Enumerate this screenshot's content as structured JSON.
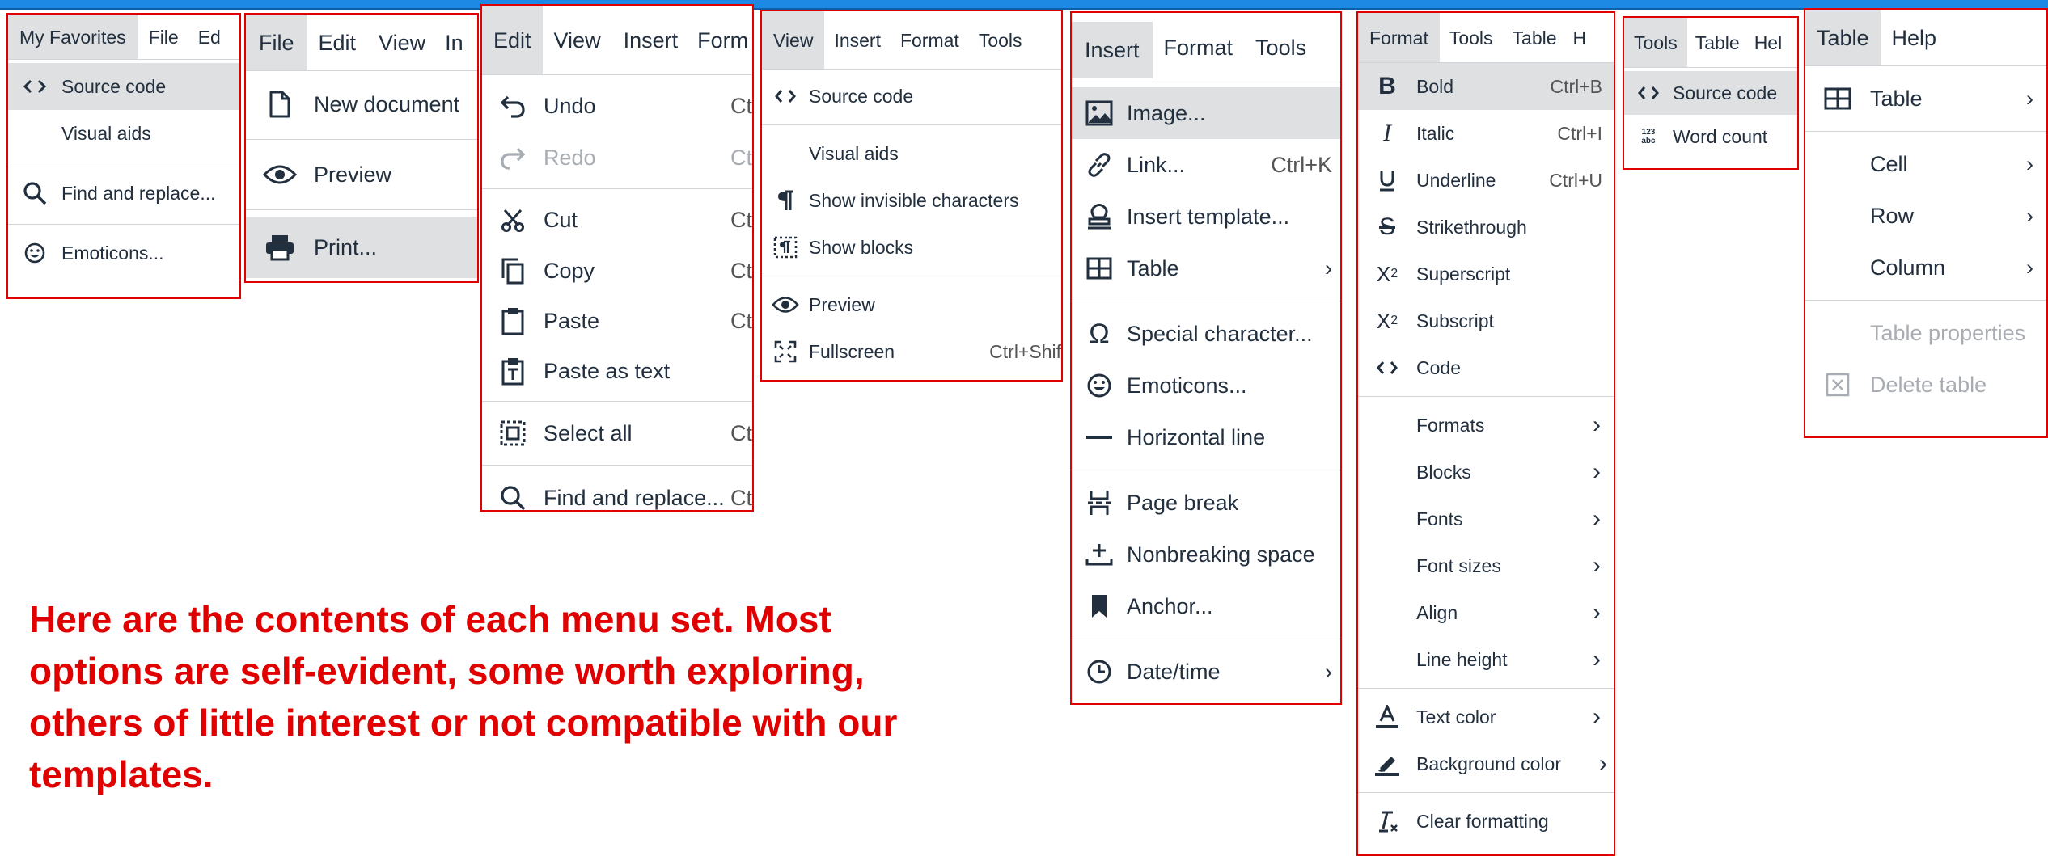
{
  "menus": {
    "favorites": {
      "bar": [
        "My Favorites",
        "File",
        "Ed"
      ],
      "items": [
        {
          "label": "Source code",
          "icon": "source-code-icon"
        },
        {
          "label": "Visual aids",
          "icon": ""
        },
        {
          "label": "Find and replace...",
          "icon": "search-icon"
        },
        {
          "label": "Emoticons...",
          "icon": "emoticons-icon"
        }
      ]
    },
    "file": {
      "bar": [
        "File",
        "Edit",
        "View",
        "In"
      ],
      "items": [
        {
          "label": "New document",
          "icon": "new-document-icon"
        },
        {
          "label": "Preview",
          "icon": "preview-icon"
        },
        {
          "label": "Print...",
          "icon": "print-icon"
        }
      ]
    },
    "edit": {
      "bar": [
        "Edit",
        "View",
        "Insert",
        "Form"
      ],
      "items": [
        {
          "label": "Undo",
          "shortcut": "Ct",
          "icon": "undo-icon"
        },
        {
          "label": "Redo",
          "shortcut": "Ct",
          "icon": "redo-icon"
        },
        {
          "label": "Cut",
          "shortcut": "Ct",
          "icon": "cut-icon"
        },
        {
          "label": "Copy",
          "shortcut": "Ct",
          "icon": "copy-icon"
        },
        {
          "label": "Paste",
          "shortcut": "Ct",
          "icon": "paste-icon"
        },
        {
          "label": "Paste as text",
          "shortcut": "",
          "icon": "paste-as-text-icon"
        },
        {
          "label": "Select all",
          "shortcut": "Ct",
          "icon": "select-all-icon"
        },
        {
          "label": "Find and replace...",
          "shortcut": "Ct",
          "icon": "search-icon"
        }
      ]
    },
    "view": {
      "bar": [
        "View",
        "Insert",
        "Format",
        "Tools"
      ],
      "items": [
        {
          "label": "Source code",
          "shortcut": "",
          "icon": "source-code-icon"
        },
        {
          "label": "Visual aids",
          "shortcut": "",
          "icon": ""
        },
        {
          "label": "Show invisible characters",
          "shortcut": "",
          "icon": "pilcrow-icon"
        },
        {
          "label": "Show blocks",
          "shortcut": "",
          "icon": "show-blocks-icon"
        },
        {
          "label": "Preview",
          "shortcut": "",
          "icon": "preview-icon"
        },
        {
          "label": "Fullscreen",
          "shortcut": "Ctrl+Shif",
          "icon": "fullscreen-icon"
        }
      ]
    },
    "insert": {
      "bar": [
        "Insert",
        "Format",
        "Tools"
      ],
      "items": [
        {
          "label": "Image...",
          "shortcut": "",
          "icon": "image-icon"
        },
        {
          "label": "Link...",
          "shortcut": "Ctrl+K",
          "icon": "link-icon"
        },
        {
          "label": "Insert template...",
          "shortcut": "",
          "icon": "template-icon"
        },
        {
          "label": "Table",
          "shortcut": "",
          "icon": "table-icon"
        },
        {
          "label": "Special character...",
          "shortcut": "",
          "icon": "omega-icon"
        },
        {
          "label": "Emoticons...",
          "shortcut": "",
          "icon": "emoticons-icon"
        },
        {
          "label": "Horizontal line",
          "shortcut": "",
          "icon": "horizontal-line-icon"
        },
        {
          "label": "Page break",
          "shortcut": "",
          "icon": "page-break-icon"
        },
        {
          "label": "Nonbreaking space",
          "shortcut": "",
          "icon": "nonbreaking-space-icon"
        },
        {
          "label": "Anchor...",
          "shortcut": "",
          "icon": "bookmark-icon"
        },
        {
          "label": "Date/time",
          "shortcut": "",
          "icon": "clock-icon"
        }
      ]
    },
    "format": {
      "bar": [
        "Format",
        "Tools",
        "Table",
        "H"
      ],
      "items": [
        {
          "label": "Bold",
          "shortcut": "Ctrl+B",
          "icon": "bold-icon"
        },
        {
          "label": "Italic",
          "shortcut": "Ctrl+I",
          "icon": "italic-icon"
        },
        {
          "label": "Underline",
          "shortcut": "Ctrl+U",
          "icon": "underline-icon"
        },
        {
          "label": "Strikethrough",
          "shortcut": "",
          "icon": "strikethrough-icon"
        },
        {
          "label": "Superscript",
          "shortcut": "",
          "icon": "superscript-icon"
        },
        {
          "label": "Subscript",
          "shortcut": "",
          "icon": "subscript-icon"
        },
        {
          "label": "Code",
          "shortcut": "",
          "icon": "source-code-icon"
        },
        {
          "label": "Formats",
          "shortcut": "",
          "icon": ""
        },
        {
          "label": "Blocks",
          "shortcut": "",
          "icon": ""
        },
        {
          "label": "Fonts",
          "shortcut": "",
          "icon": ""
        },
        {
          "label": "Font sizes",
          "shortcut": "",
          "icon": ""
        },
        {
          "label": "Align",
          "shortcut": "",
          "icon": ""
        },
        {
          "label": "Line height",
          "shortcut": "",
          "icon": ""
        },
        {
          "label": "Text color",
          "shortcut": "",
          "icon": "text-color-icon"
        },
        {
          "label": "Background color",
          "shortcut": "",
          "icon": "highlight-icon"
        },
        {
          "label": "Clear formatting",
          "shortcut": "",
          "icon": "clear-formatting-icon"
        }
      ]
    },
    "tools": {
      "bar": [
        "Tools",
        "Table",
        "Hel"
      ],
      "items": [
        {
          "label": "Source code",
          "icon": "source-code-icon"
        },
        {
          "label": "Word count",
          "icon": "word-count-icon",
          "badge_top": "123",
          "badge_bottom": "abc"
        }
      ]
    },
    "table": {
      "bar": [
        "Table",
        "Help"
      ],
      "items": [
        {
          "label": "Table",
          "icon": "table-icon"
        },
        {
          "label": "Cell",
          "icon": ""
        },
        {
          "label": "Row",
          "icon": ""
        },
        {
          "label": "Column",
          "icon": ""
        },
        {
          "label": "Table properties",
          "icon": ""
        },
        {
          "label": "Delete table",
          "icon": "delete-table-icon"
        }
      ]
    }
  },
  "caption": "Here are the contents of each menu set. Most options are self-evident, some worth exploring, others of little interest or not compatible with our templates.",
  "colors": {
    "outline": "#e00000",
    "highlight": "#dee0e2",
    "text": "#222f3e",
    "disabled": "#a8adb3",
    "caption": "#e00000"
  }
}
